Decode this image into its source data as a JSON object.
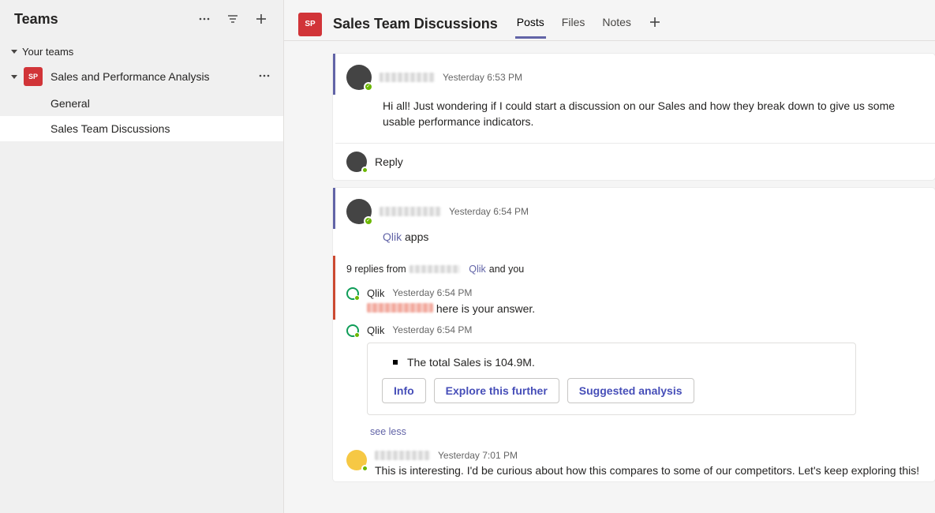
{
  "sidebar": {
    "title": "Teams",
    "section_label": "Your teams",
    "team": {
      "badge": "SP",
      "name": "Sales and Performance Analysis",
      "channels": [
        {
          "name": "General",
          "active": false
        },
        {
          "name": "Sales Team Discussions",
          "active": true
        }
      ]
    }
  },
  "header": {
    "badge": "SP",
    "channel_name": "Sales Team Discussions",
    "tabs": [
      {
        "label": "Posts",
        "active": true
      },
      {
        "label": "Files",
        "active": false
      },
      {
        "label": "Notes",
        "active": false
      }
    ]
  },
  "posts": {
    "p1": {
      "timestamp": "Yesterday 6:53 PM",
      "body": "Hi all! Just wondering if I could start a discussion on our Sales and how they break down to give us some usable performance indicators.",
      "reply_label": "Reply"
    },
    "p2": {
      "timestamp": "Yesterday 6:54 PM",
      "link_text": "Qlik",
      "body_rest": " apps",
      "thread": {
        "prefix": "9 replies from ",
        "suffix_link": "Qlik",
        "suffix_text": " and you"
      },
      "r1": {
        "name": "Qlik",
        "timestamp": "Yesterday 6:54 PM",
        "text_after": " here is your answer."
      },
      "r2": {
        "name": "Qlik",
        "timestamp": "Yesterday 6:54 PM",
        "bullet": "The total Sales is 104.9M.",
        "actions": [
          "Info",
          "Explore this further",
          "Suggested analysis"
        ]
      },
      "see_less": "see less",
      "r3": {
        "timestamp": "Yesterday 7:01 PM",
        "body": "This is interesting. I'd be curious about how this compares to some of our competitors. Let's keep exploring this!"
      }
    }
  }
}
